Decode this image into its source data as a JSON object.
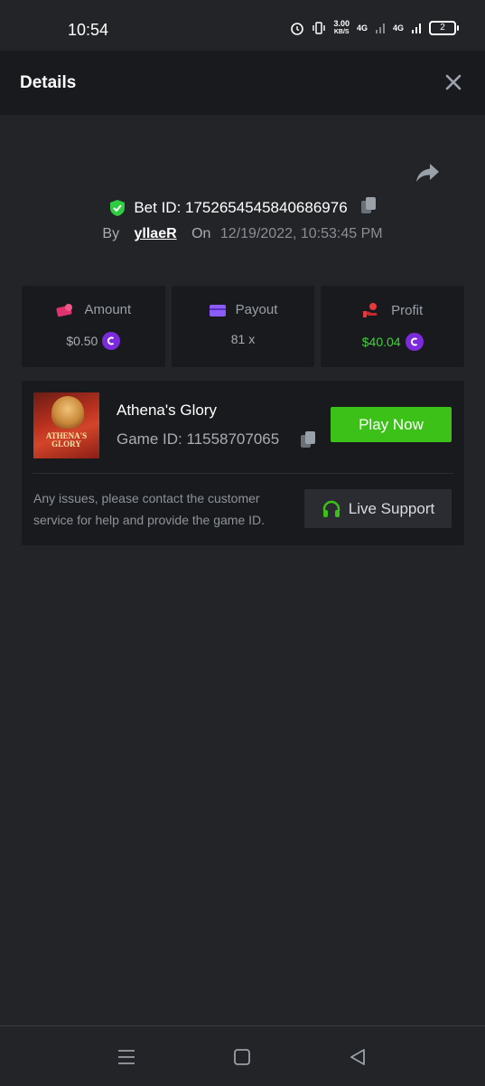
{
  "status_bar": {
    "time": "10:54",
    "speed": "3.00",
    "speed_unit": "KB/S",
    "network1": "4G",
    "network2": "4G",
    "battery": "2"
  },
  "header": {
    "title": "Details"
  },
  "bet": {
    "id_label": "Bet ID: 1752654545840686976",
    "by_label": "By",
    "user": "yllaeR",
    "on_label": "On",
    "datetime": "12/19/2022, 10:53:45 PM"
  },
  "stats": [
    {
      "label": "Amount",
      "value": "$0.50",
      "icon": "amount-icon"
    },
    {
      "label": "Payout",
      "value": "81 x",
      "icon": "wallet-icon"
    },
    {
      "label": "Profit",
      "value": "$40.04",
      "icon": "profit-icon"
    }
  ],
  "game": {
    "thumbnail_text": "ATHENA'S GLORY",
    "name": "Athena's Glory",
    "id_label": "Game ID: 11558707065",
    "play_label": "Play Now",
    "issue_text": "Any issues, please contact the customer service for help and provide the game ID.",
    "support_label": "Live Support"
  },
  "colors": {
    "accent_green": "#3bc117",
    "profit_green": "#3fd23a",
    "coin_purple": "#7b2bdc",
    "background": "#232427",
    "panel": "#191a1d"
  }
}
